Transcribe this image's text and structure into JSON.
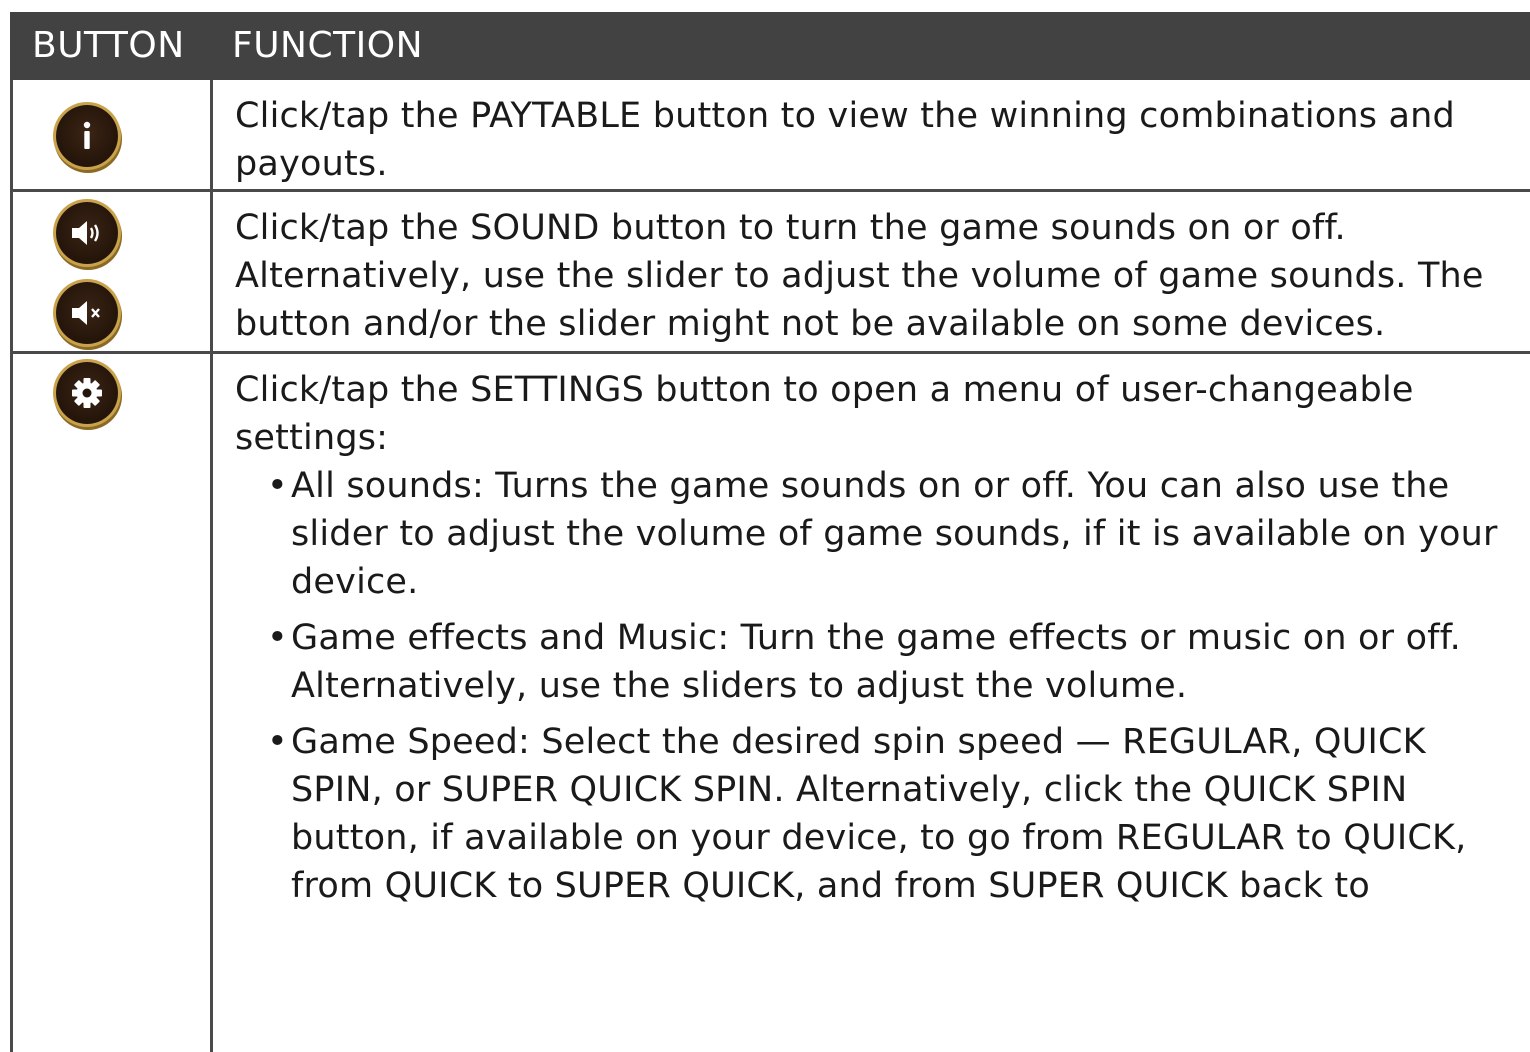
{
  "table": {
    "headers": {
      "button": "BUTTON",
      "function": "FUNCTION"
    },
    "rows": [
      {
        "icons": [
          "info-icon"
        ],
        "text": "Click/tap the PAYTABLE button to view the winning combinations and payouts."
      },
      {
        "icons": [
          "sound-on-icon",
          "sound-off-icon"
        ],
        "text": "Click/tap the SOUND button to turn the game sounds on or off. Alternatively, use the slider to adjust the volume of game sounds. The button and/or the slider might not be available on some devices."
      },
      {
        "icons": [
          "gear-icon"
        ],
        "text": "Click/tap the SETTINGS button to open a menu of user-changeable settings:",
        "bullets": [
          "All sounds: Turns the game sounds on or off. You can also use the slider to adjust the volume of game sounds, if it is available on your device.",
          "Game effects and Music: Turn the game effects or music on or off. Alternatively, use the sliders to adjust the volume.",
          "Game Speed: Select the desired spin speed — REGULAR, QUICK SPIN, or SUPER QUICK SPIN. Alternatively, click the QUICK SPIN button, if available on your device, to go from REGULAR to QUICK, from QUICK to SUPER QUICK, and from SUPER QUICK back to"
        ]
      }
    ]
  },
  "colors": {
    "header_bg": "#424242",
    "icon_fill": "#241409",
    "icon_ring": "#c9a24a"
  }
}
